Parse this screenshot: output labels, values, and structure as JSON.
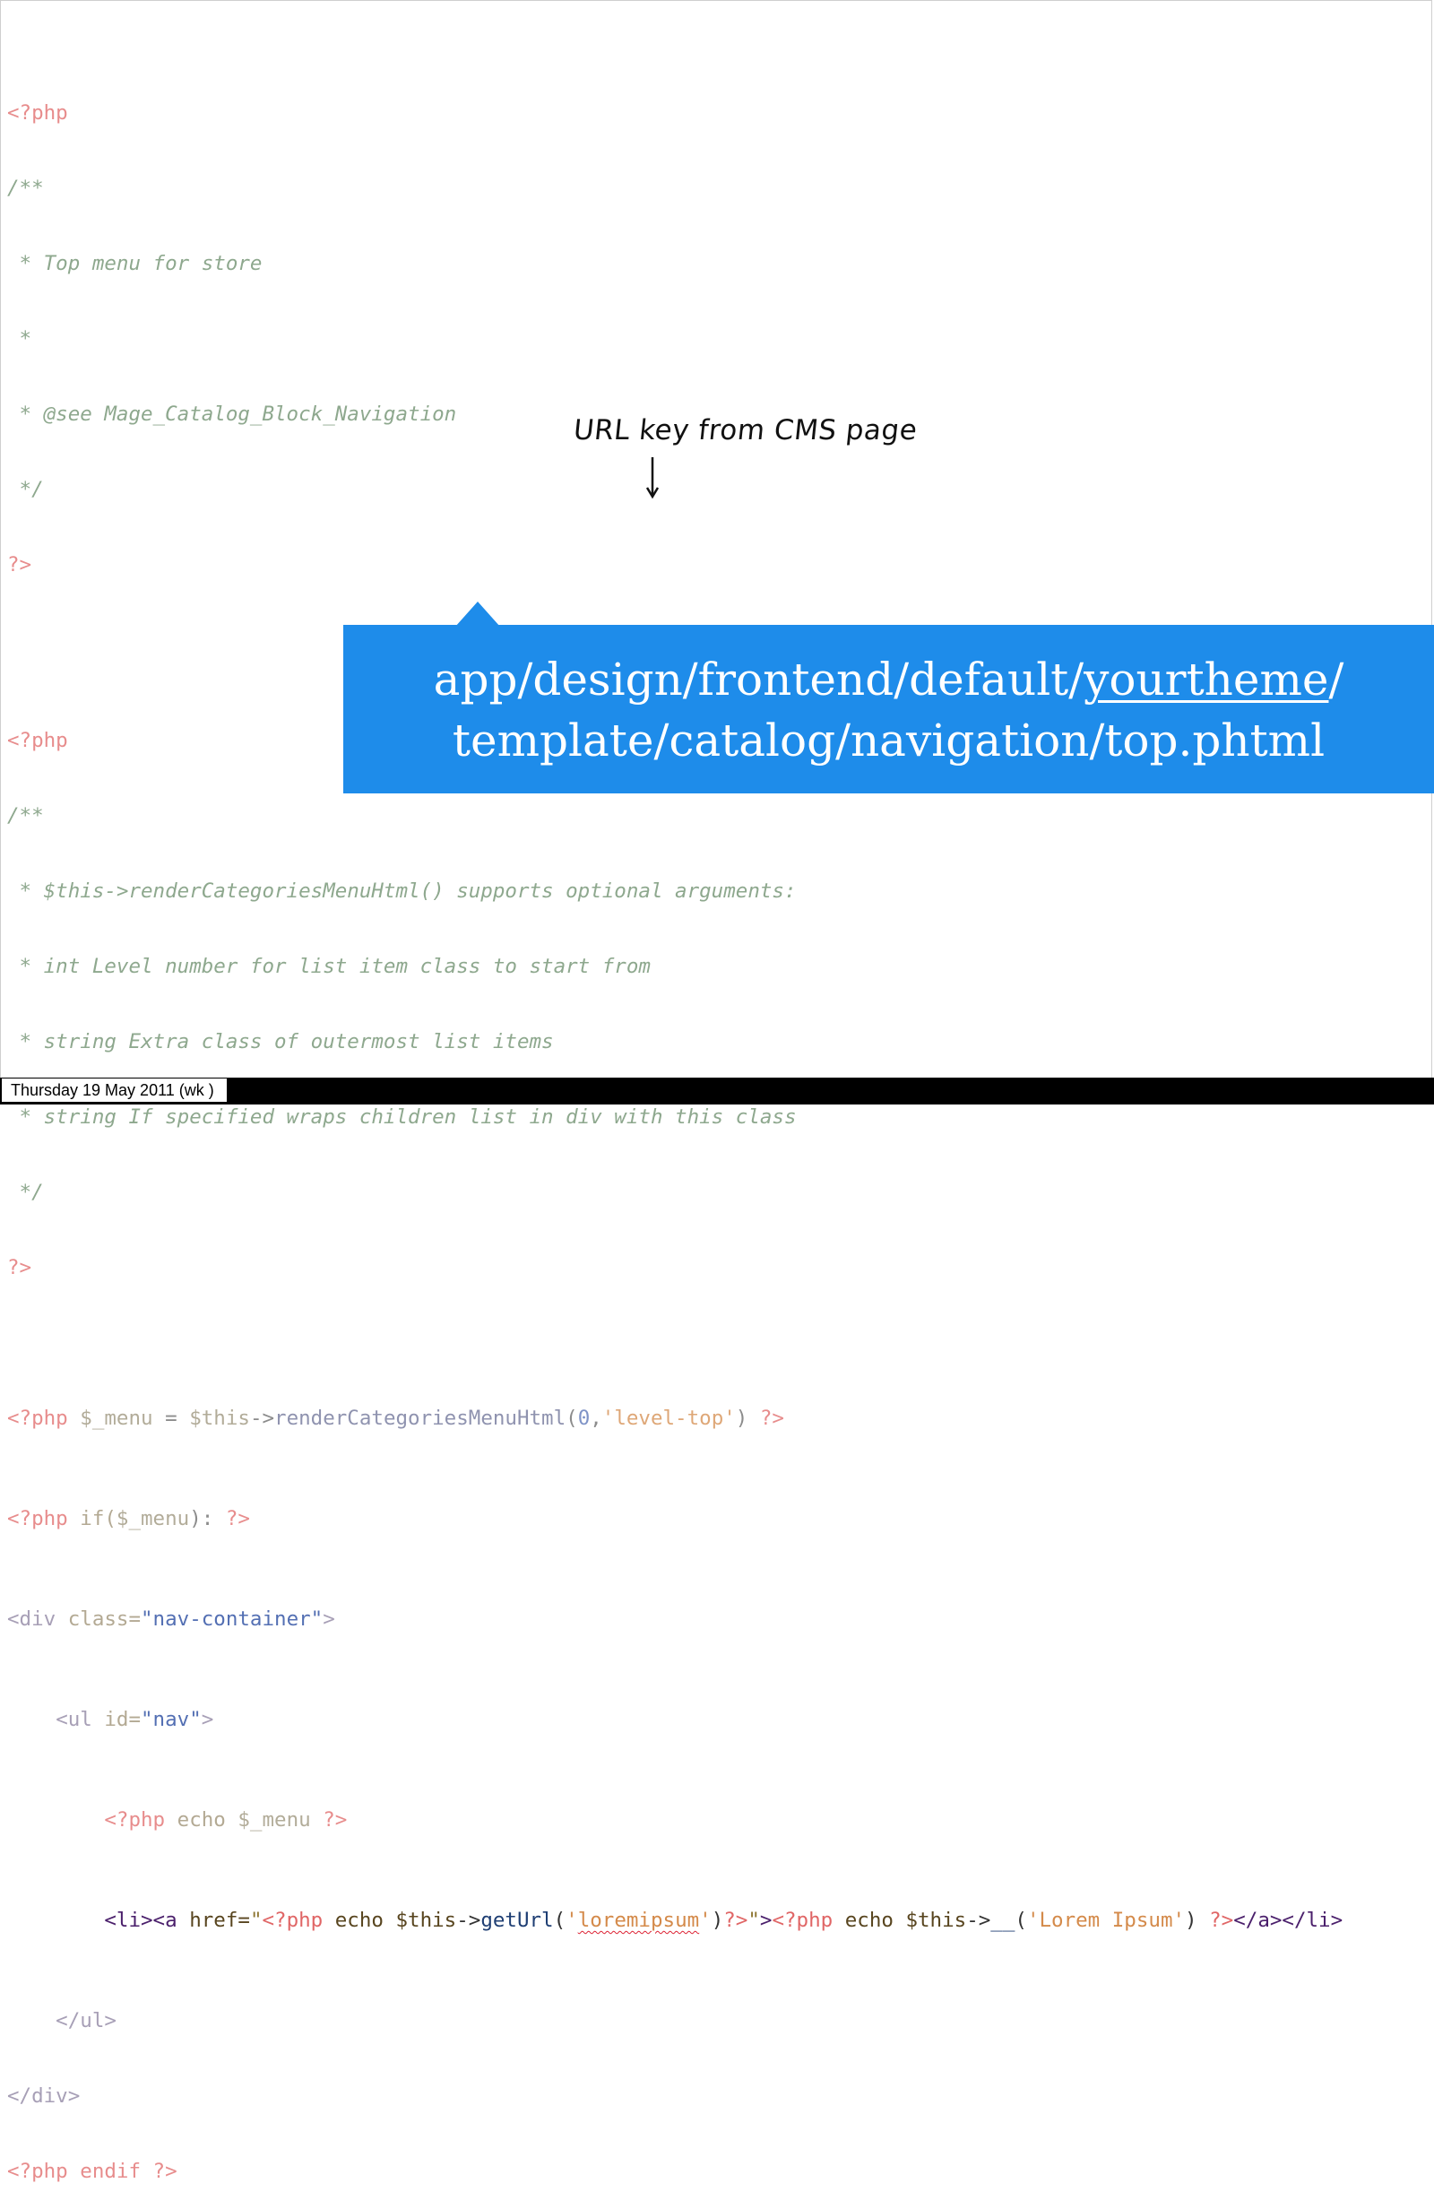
{
  "code": {
    "comment_block_1": [
      "<?php",
      "/**",
      " * Top menu for store",
      " *",
      " * @see Mage_Catalog_Block_Navigation",
      " */",
      "?>"
    ],
    "comment_block_2": [
      "<?php",
      "/**",
      " * $this->renderCategoriesMenuHtml() supports optional arguments:",
      " * int Level number for list item class to start from",
      " * string Extra class of outermost list items",
      " * string If specified wraps children list in div with this class",
      " */",
      "?>"
    ],
    "menu_assign": {
      "open": "<?php",
      "var": " $_menu",
      "eq": " = ",
      "this": "$this",
      "arrow": "->",
      "fn": "renderCategoriesMenuHtml",
      "paren_open": "(",
      "num": "0",
      "comma": ",",
      "str": "'level-top'",
      "paren_close": ")",
      "close": " ?>"
    },
    "if_line": {
      "open": "<?php",
      "kw": " if(",
      "var": "$_menu",
      "rest": "): ",
      "close": "?>"
    },
    "div_line": {
      "tag_open": "<div",
      "attr": " class=",
      "val": "\"nav-container\"",
      "tag_close": ">"
    },
    "ul_line": {
      "indent": "    ",
      "tag_open": "<ul",
      "attr": " id=",
      "val": "\"nav\"",
      "tag_close": ">"
    },
    "echo_line": {
      "indent": "        ",
      "open": "<?php",
      "kw": " echo ",
      "var": "$_menu",
      "close": " ?>"
    },
    "li_line": {
      "indent": "        ",
      "tags": "<li><a",
      "attr": " href=",
      "q1": "\"",
      "php1": "<?php",
      "echo1": " echo ",
      "this1": "$this",
      "arrow1": "->",
      "fn1": "getUrl",
      "p1": "(",
      "s1a": "'",
      "key": "loremipsum",
      "s1b": "'",
      "p1c": ")",
      "close1": "?>",
      "q2": "\"",
      "gt": ">",
      "php2": "<?php",
      "echo2": " echo ",
      "this2": "$this",
      "arrow2": "->",
      "fn2": "__",
      "p2": "(",
      "s2": "'Lorem Ipsum'",
      "p2c": ")",
      "close2": " ?>",
      "end_tags": "</a></li>"
    },
    "ul_close": "    </ul>",
    "div_close": "</div>",
    "endif_line": "<?php endif ?>"
  },
  "annotation": {
    "text": "URL key from CMS page",
    "arrow_icon": "down-arrow-icon"
  },
  "callout": {
    "path_part1": "app/design/frontend/default/",
    "path_theme": "yourtheme",
    "path_part2": "/",
    "path_line2": "template/catalog/navigation/top.phtml",
    "color": "#1e8cea"
  },
  "footer": {
    "label": "Thursday 19 May 2011 (wk )"
  }
}
